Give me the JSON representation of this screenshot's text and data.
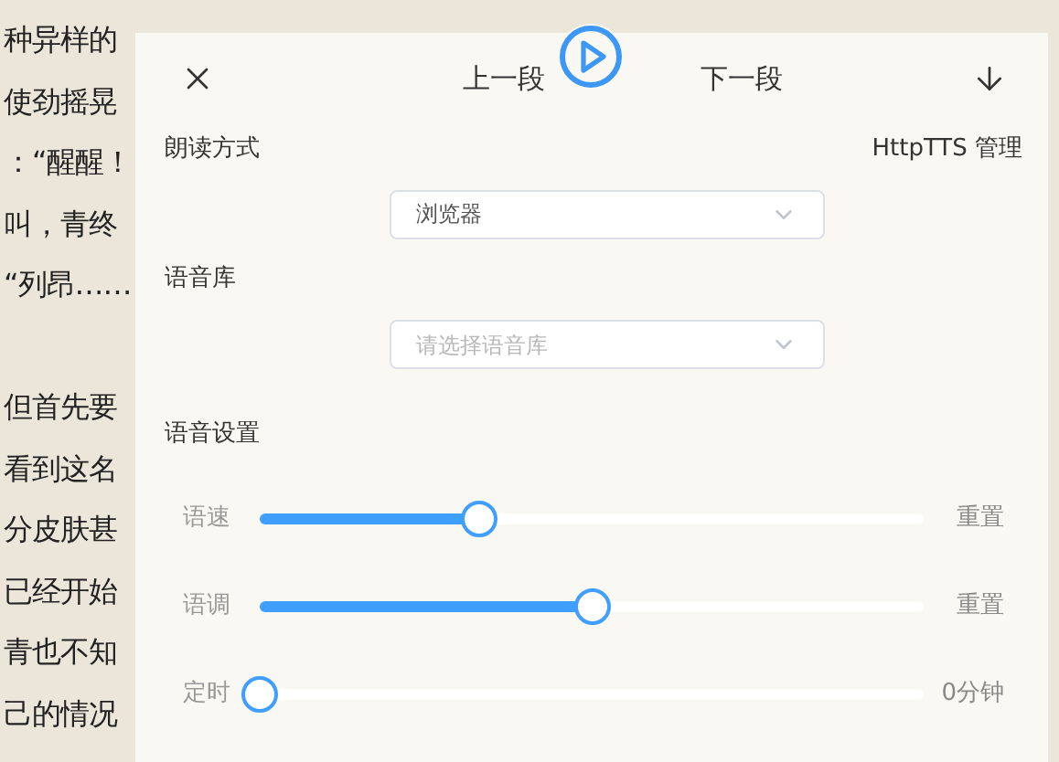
{
  "background_paragraphs": [
    [
      "种异样的",
      "使劲摇晃",
      "：“醒醒！",
      "叫，青终",
      "“列昂……"
    ],
    [
      "但首先要",
      "看到这名",
      "分皮肤甚",
      "已经开始",
      "青也不知",
      "己的情况"
    ]
  ],
  "header": {
    "prev": "上一段",
    "next": "下一段",
    "playing": false
  },
  "read_mode": {
    "label": "朗读方式",
    "manage_link": "HttpTTS 管理",
    "value": "浏览器"
  },
  "voice_library": {
    "label": "语音库",
    "placeholder": "请选择语音库"
  },
  "voice_settings": {
    "label": "语音设置",
    "sliders": [
      {
        "label": "语速",
        "level": 0.33,
        "action": "重置"
      },
      {
        "label": "语调",
        "level": 0.5,
        "action": "重置"
      },
      {
        "label": "定时",
        "level": 0,
        "action": "0分钟"
      }
    ]
  }
}
